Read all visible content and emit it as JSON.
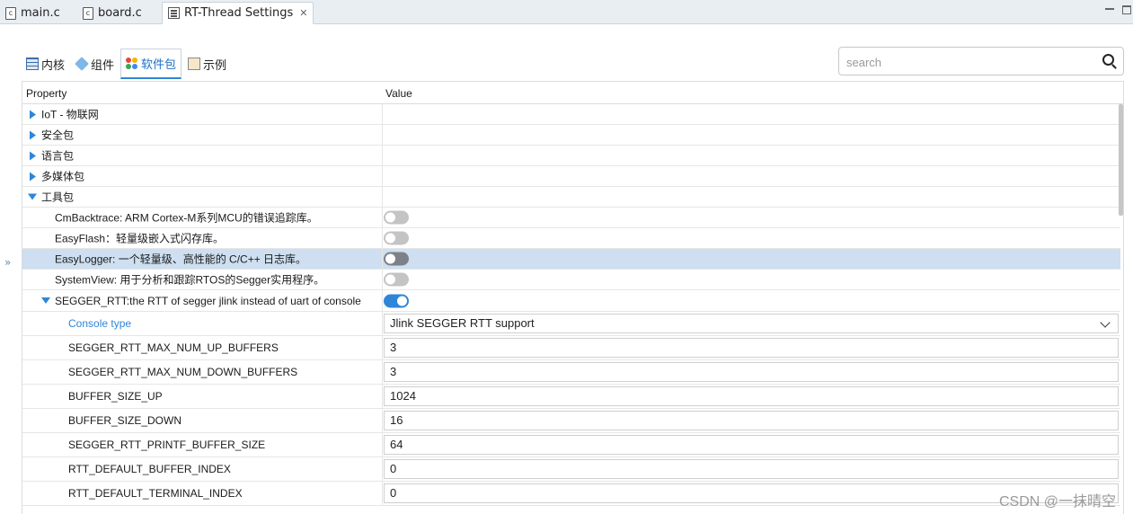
{
  "editor_tabs": [
    {
      "label": "main.c",
      "icon": "c-file-icon"
    },
    {
      "label": "board.c",
      "icon": "c-file-icon"
    },
    {
      "label": "RT-Thread Settings",
      "icon": "settings-file-icon",
      "active": true
    }
  ],
  "category_tabs": [
    {
      "label": "内核",
      "icon": "kernel-icon"
    },
    {
      "label": "组件",
      "icon": "component-icon"
    },
    {
      "label": "软件包",
      "icon": "package-icon",
      "active": true
    },
    {
      "label": "示例",
      "icon": "example-icon"
    }
  ],
  "search": {
    "placeholder": "search",
    "value": ""
  },
  "table": {
    "header_property": "Property",
    "header_value": "Value",
    "rows": [
      {
        "label": "IoT - 物联网",
        "level": 0,
        "expander": "collapsed"
      },
      {
        "label": "安全包",
        "level": 0,
        "expander": "collapsed"
      },
      {
        "label": "语言包",
        "level": 0,
        "expander": "collapsed"
      },
      {
        "label": "多媒体包",
        "level": 0,
        "expander": "collapsed"
      },
      {
        "label": "工具包",
        "level": 0,
        "expander": "expanded"
      },
      {
        "label": "CmBacktrace: ARM Cortex-M系列MCU的错误追踪库。",
        "level": 1,
        "toggle": false
      },
      {
        "label": "EasyFlash：轻量级嵌入式闪存库。",
        "level": 1,
        "toggle": false
      },
      {
        "label": "EasyLogger: 一个轻量级、高性能的 C/C++ 日志库。",
        "level": 1,
        "toggle": false,
        "selected": true
      },
      {
        "label": "SystemView: 用于分析和跟踪RTOS的Segger实用程序。",
        "level": 1,
        "toggle": false
      },
      {
        "label": "SEGGER_RTT:the RTT of segger jlink instead of uart of console",
        "level": 1,
        "expander": "expanded",
        "toggle": true
      },
      {
        "label": "Console type",
        "level": 2,
        "link": true,
        "select": "Jlink SEGGER RTT support"
      },
      {
        "label": "SEGGER_RTT_MAX_NUM_UP_BUFFERS",
        "level": 2,
        "value": "3"
      },
      {
        "label": "SEGGER_RTT_MAX_NUM_DOWN_BUFFERS",
        "level": 2,
        "value": "3"
      },
      {
        "label": "BUFFER_SIZE_UP",
        "level": 2,
        "value": "1024"
      },
      {
        "label": "BUFFER_SIZE_DOWN",
        "level": 2,
        "value": "16"
      },
      {
        "label": "SEGGER_RTT_PRINTF_BUFFER_SIZE",
        "level": 2,
        "value": "64"
      },
      {
        "label": "RTT_DEFAULT_BUFFER_INDEX",
        "level": 2,
        "value": "0"
      },
      {
        "label": "RTT_DEFAULT_TERMINAL_INDEX",
        "level": 2,
        "value": "0"
      }
    ]
  },
  "left_collapse": "»",
  "watermark": "CSDN @一抹晴空",
  "colors": {
    "accent": "#2f86d8",
    "selected_row": "#cddff0"
  }
}
